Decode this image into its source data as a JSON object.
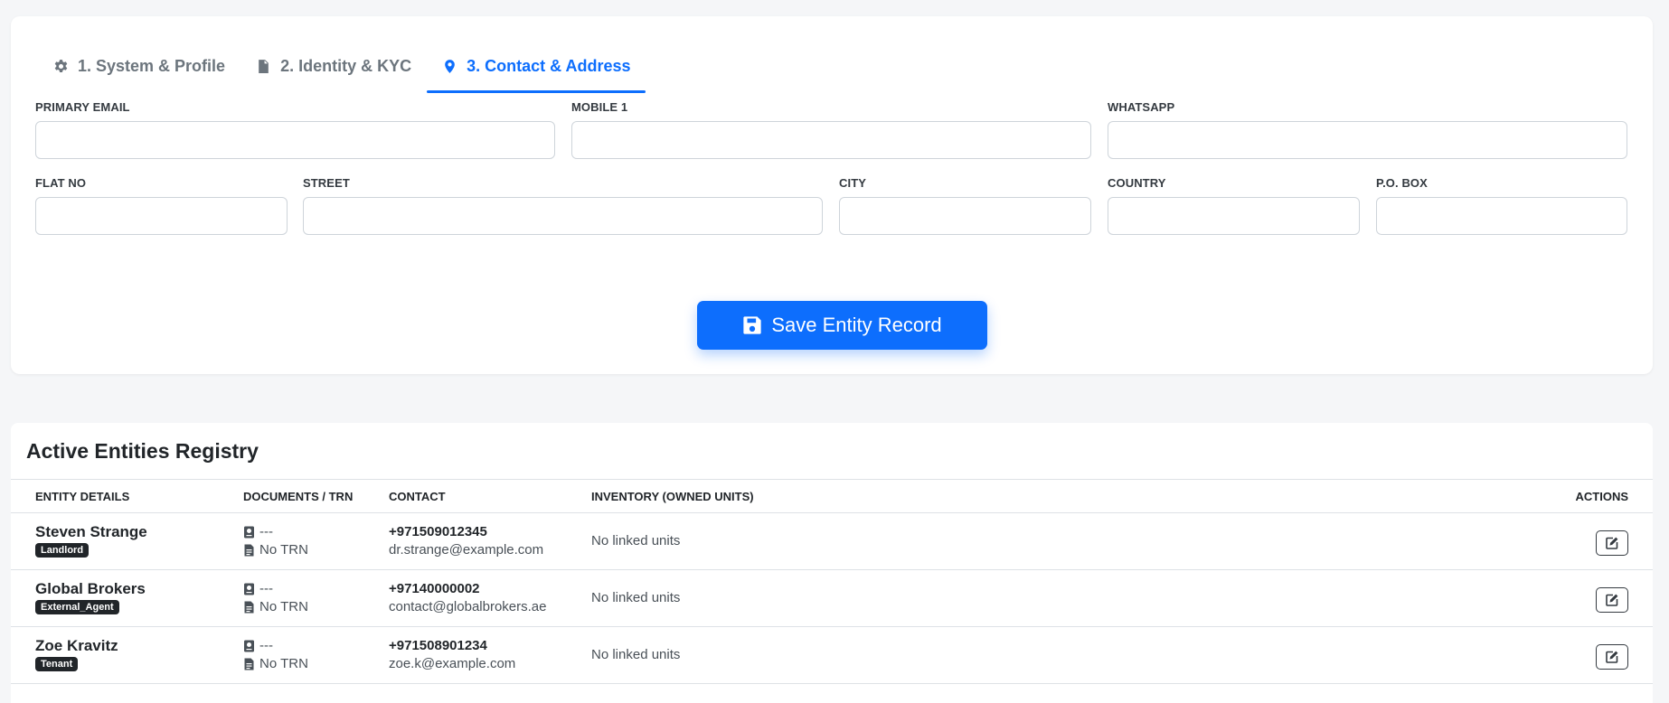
{
  "tabs": [
    {
      "label": "1. System & Profile",
      "icon": "gear-icon",
      "active": false
    },
    {
      "label": "2. Identity & KYC",
      "icon": "document-icon",
      "active": false
    },
    {
      "label": "3. Contact & Address",
      "icon": "map-pin-icon",
      "active": true
    }
  ],
  "form": {
    "primary_email": {
      "label": "PRIMARY EMAIL",
      "value": ""
    },
    "mobile_1": {
      "label": "MOBILE 1",
      "value": ""
    },
    "whatsapp": {
      "label": "WHATSAPP",
      "value": ""
    },
    "flat_no": {
      "label": "FLAT NO",
      "value": ""
    },
    "street": {
      "label": "STREET",
      "value": ""
    },
    "city": {
      "label": "CITY",
      "value": ""
    },
    "country": {
      "label": "COUNTRY",
      "value": ""
    },
    "po_box": {
      "label": "P.O. BOX",
      "value": ""
    }
  },
  "save_button": {
    "label": "Save Entity Record",
    "icon": "floppy-disk-icon"
  },
  "registry": {
    "title": "Active Entities Registry",
    "columns": [
      "ENTITY DETAILS",
      "DOCUMENTS / TRN",
      "CONTACT",
      "INVENTORY (OWNED UNITS)",
      "ACTIONS"
    ],
    "rows": [
      {
        "name": "Steven Strange",
        "role": "Landlord",
        "passport": "---",
        "trn": "No TRN",
        "phone": "+971509012345",
        "email": "dr.strange@example.com",
        "inventory": "No linked units"
      },
      {
        "name": "Global Brokers",
        "role": "External_Agent",
        "passport": "---",
        "trn": "No TRN",
        "phone": "+97140000002",
        "email": "contact@globalbrokers.ae",
        "inventory": "No linked units"
      },
      {
        "name": "Zoe Kravitz",
        "role": "Tenant",
        "passport": "---",
        "trn": "No TRN",
        "phone": "+971508901234",
        "email": "zoe.k@example.com",
        "inventory": "No linked units"
      }
    ]
  },
  "colors": {
    "accent": "#0d6efd",
    "badge": "#212529",
    "page_background": "#f5f6f8"
  }
}
